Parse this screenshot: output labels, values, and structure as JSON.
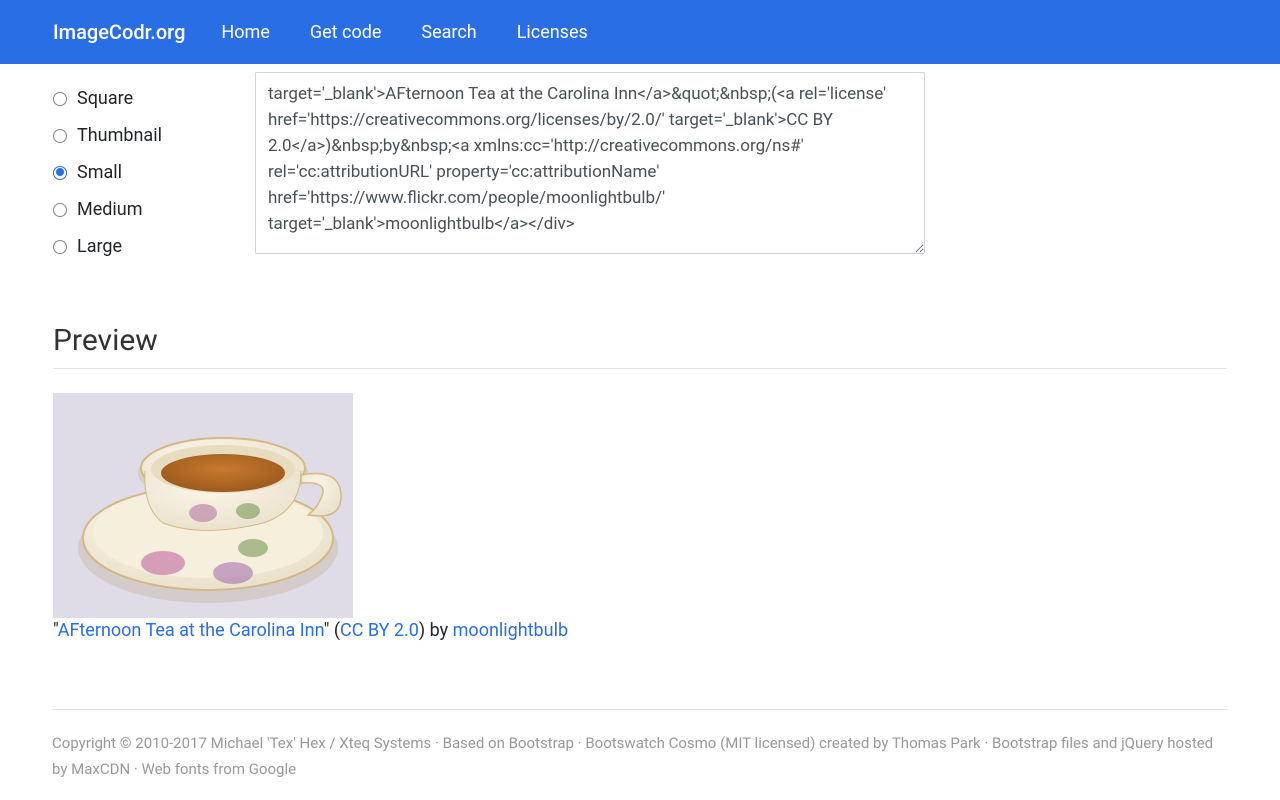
{
  "navbar": {
    "brand": "ImageCodr.org",
    "links": [
      "Home",
      "Get code",
      "Search",
      "Licenses"
    ]
  },
  "sizes": [
    {
      "label": "Square",
      "checked": false
    },
    {
      "label": "Thumbnail",
      "checked": false
    },
    {
      "label": "Small",
      "checked": true
    },
    {
      "label": "Medium",
      "checked": false
    },
    {
      "label": "Large",
      "checked": false
    }
  ],
  "code_textarea": "target='_blank'>AFternoon Tea at the Carolina Inn</a>&quot;&nbsp;(<a rel='license' href='https://creativecommons.org/licenses/by/2.0/' target='_blank'>CC BY 2.0</a>)&nbsp;by&nbsp;<a xmlns:cc='http://creativecommons.org/ns#' rel='cc:attributionURL' property='cc:attributionName' href='https://www.flickr.com/people/moonlightbulb/' target='_blank'>moonlightbulb</a></div>",
  "preview": {
    "heading": "Preview",
    "quote_open": "\"",
    "title": "AFternoon Tea at the Carolina Inn",
    "quote_close_paren": "\" (",
    "license": "CC BY 2.0",
    "paren_by": ") by ",
    "author": "moonlightbulb"
  },
  "footer": {
    "text": "Copyright © 2010-2017 Michael 'Tex' Hex / Xteq Systems · Based on Bootstrap · Bootswatch Cosmo (MIT licensed) created by Thomas Park · Bootstrap files and jQuery hosted by MaxCDN · Web fonts from Google"
  }
}
